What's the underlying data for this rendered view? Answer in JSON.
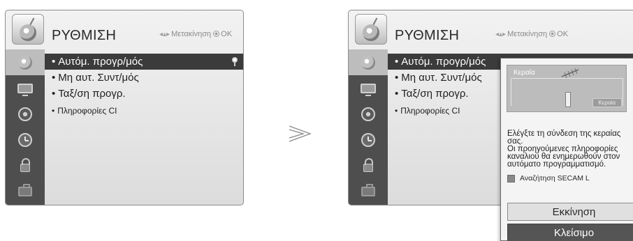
{
  "menu": {
    "title": "ΡΥΘΜΙΣΗ",
    "nav_hint": "Μετακίνηση",
    "ok_label": "OK",
    "items": [
      {
        "bullet": "•",
        "label": "Αυτόμ. προγρ/μός"
      },
      {
        "bullet": "•",
        "label": "Μη αυτ. Συντ/μός"
      },
      {
        "bullet": "•",
        "label": "Ταξ/ση προγρ."
      },
      {
        "bullet": "•",
        "label": "Πληροφορίες CI"
      }
    ],
    "sidebar_icons": [
      "setup-disc-icon",
      "picture-tv-icon",
      "audio-speaker-icon",
      "time-clock-icon",
      "lock-icon",
      "option-case-icon"
    ]
  },
  "popup": {
    "antenna_label": "Κεραία",
    "tv_label": "Κεραία",
    "message": "Ελέγξτε τη σύνδεση της κεραίας σας.\nΟι προηγούμενες πληροφορίες\nκαναλιού θα ενημερωθούν στον\nαυτόματο προγραμματισμό.",
    "checkbox_label": "Αναζήτηση SECAM L",
    "checkbox_checked": false,
    "start_button": "Εκκίνηση",
    "close_button": "Κλείσιμο"
  },
  "colors": {
    "sidebar": "#4e4e4e",
    "selected_row": "#3b3b3b",
    "close_button": "#555555"
  }
}
